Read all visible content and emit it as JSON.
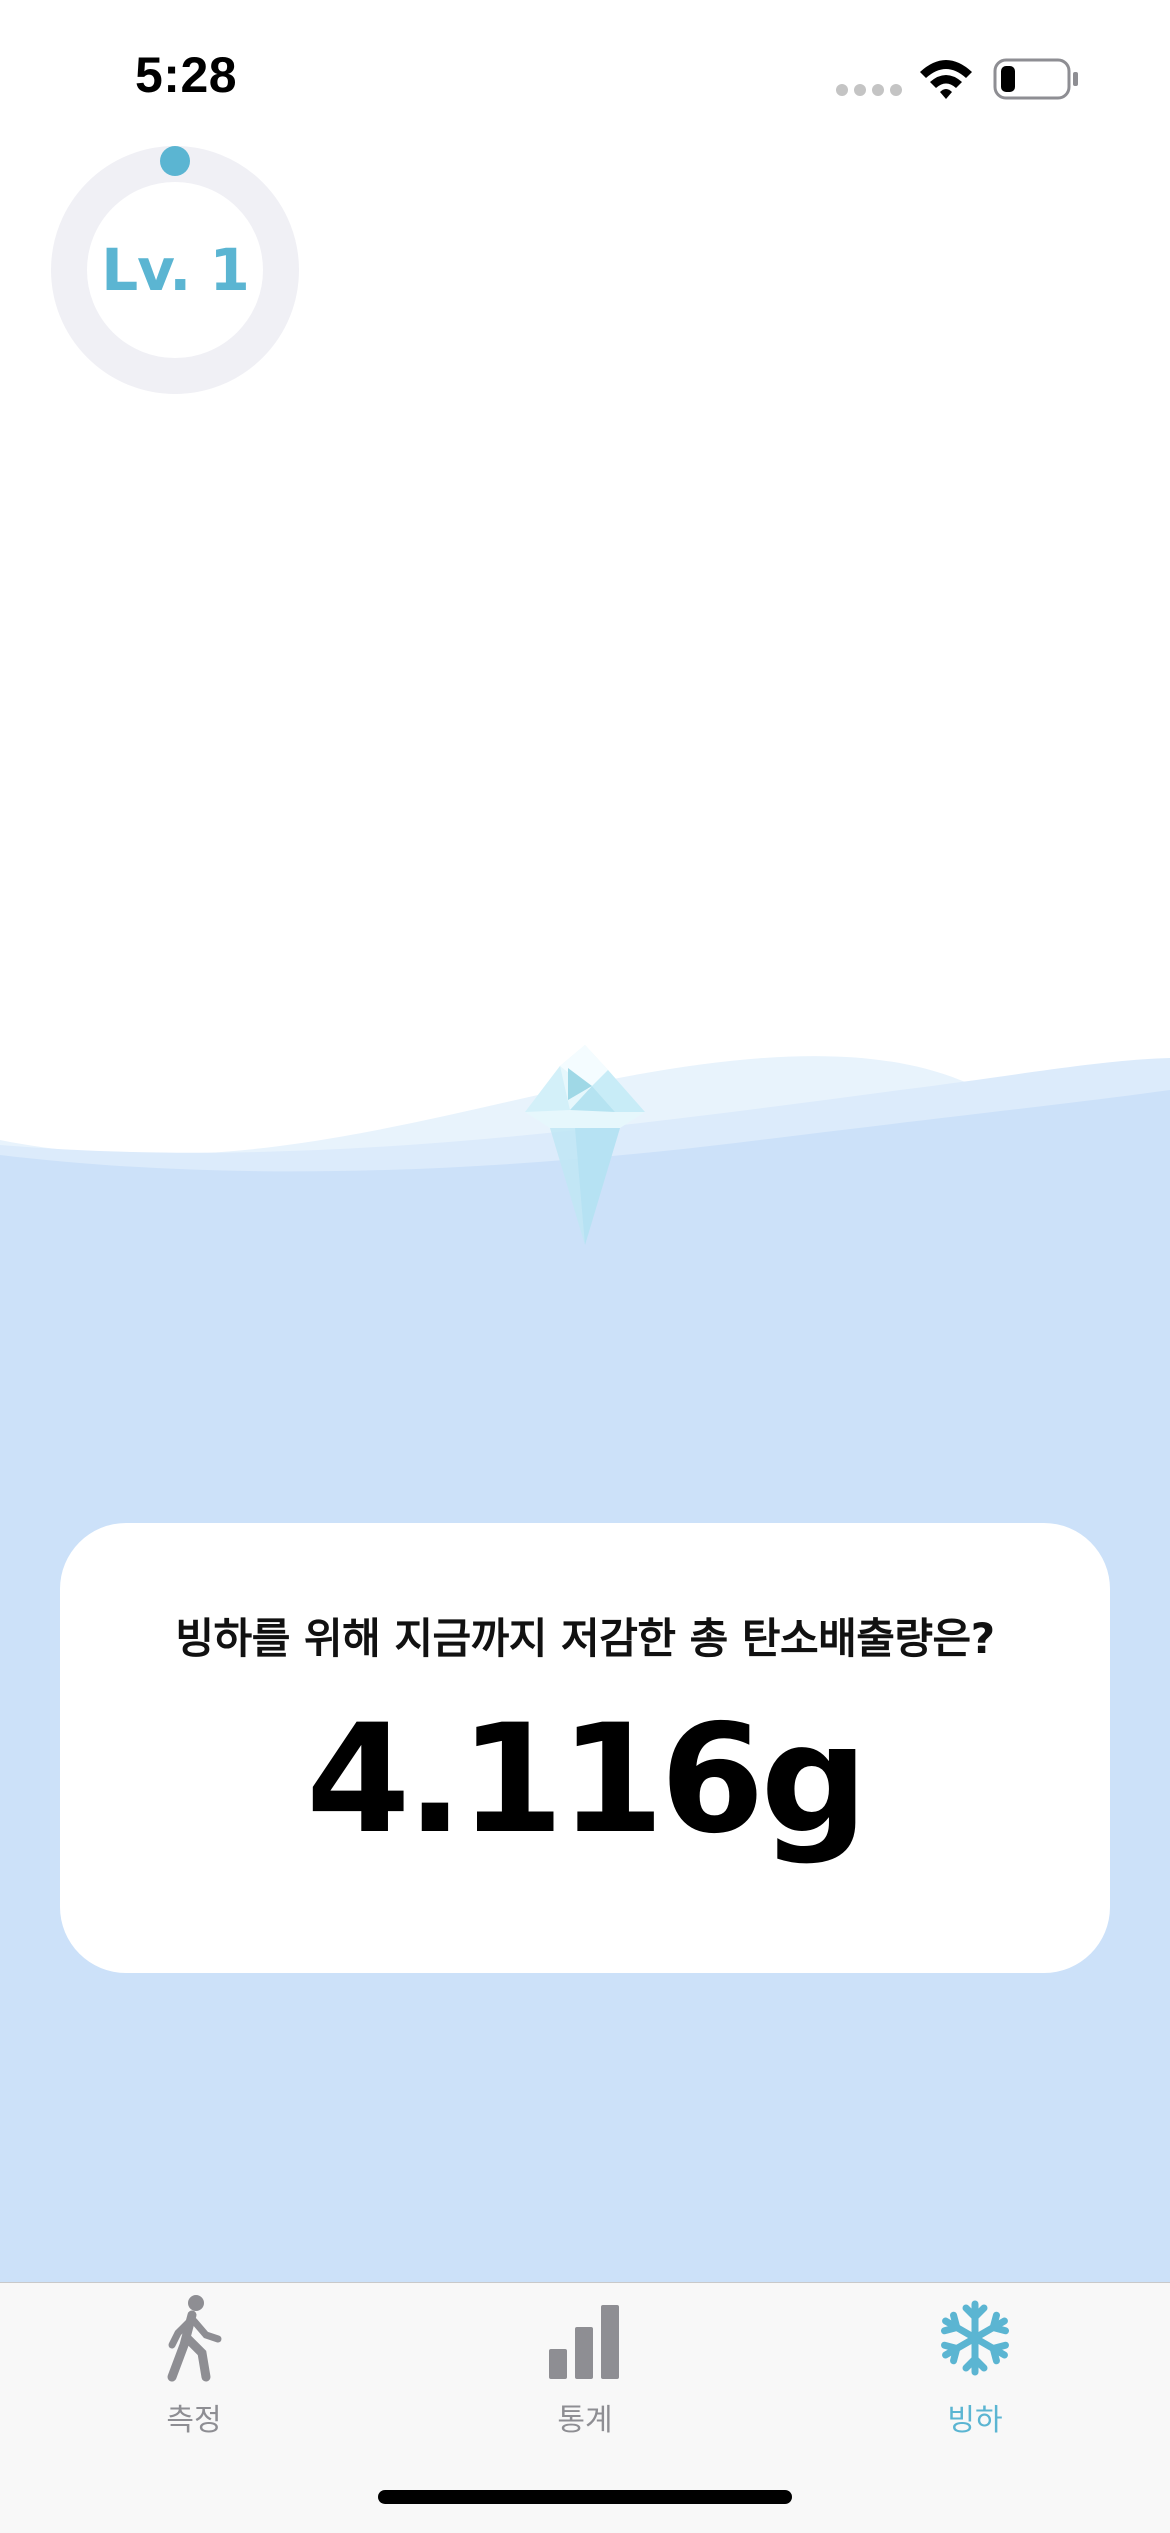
{
  "status_bar": {
    "time": "5:28",
    "icons": [
      "signal-dots-icon",
      "wifi-icon",
      "battery-icon"
    ]
  },
  "level": {
    "label": "Lv. 1",
    "progress": 0,
    "ring_color": "#f0f0f5",
    "accent_color": "#5bb5d2"
  },
  "scene": {
    "water_color": "#cce1f9",
    "iceberg": "iceberg-icon"
  },
  "card": {
    "question": "빙하를 위해 지금까지 저감한 총 탄소배출량은?",
    "value": "4.116g"
  },
  "tab_bar": {
    "active_color": "#5bb5d2",
    "inactive_color": "#8e8e93",
    "tabs": [
      {
        "label": "측정",
        "icon": "walking-person-icon",
        "active": false
      },
      {
        "label": "통계",
        "icon": "bar-chart-icon",
        "active": false
      },
      {
        "label": "빙하",
        "icon": "snowflake-icon",
        "active": true
      }
    ]
  }
}
